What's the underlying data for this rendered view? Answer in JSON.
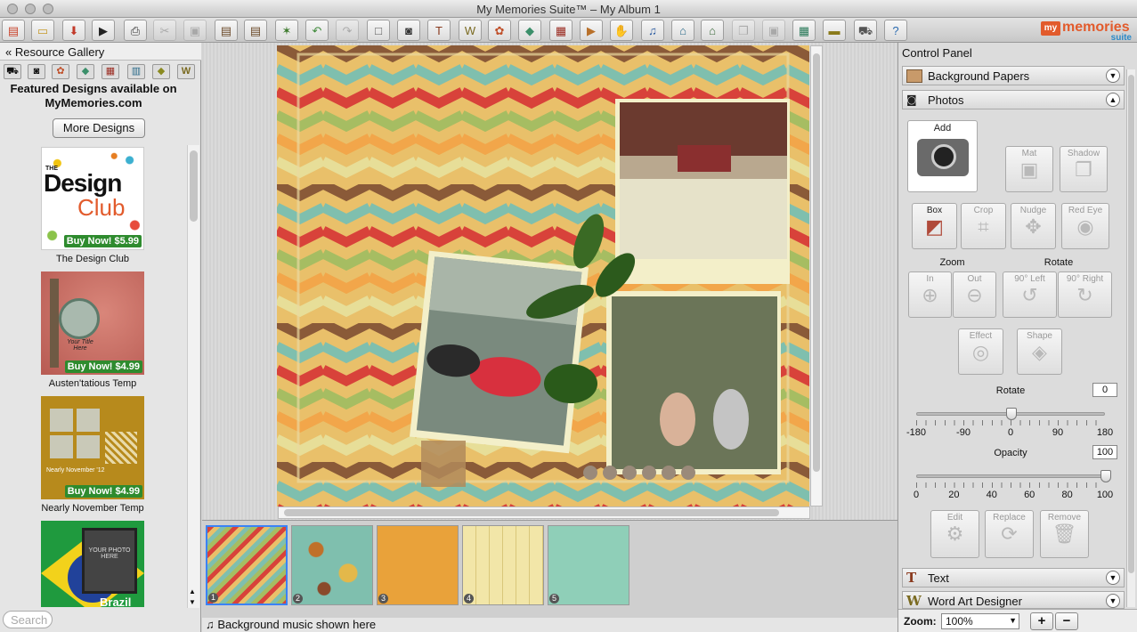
{
  "window": {
    "title": "My Memories Suite™ – My Album 1"
  },
  "toolbar": {
    "items": [
      {
        "name": "mm-home-icon",
        "glyph": "▤",
        "color": "#c9432c",
        "disabled": false
      },
      {
        "name": "open-folder-icon",
        "glyph": "▭",
        "color": "#c79a2a",
        "disabled": false
      },
      {
        "name": "save-icon",
        "glyph": "⬇",
        "color": "#c23a2a",
        "disabled": false
      },
      {
        "name": "play-icon",
        "glyph": "▶",
        "color": "#222",
        "disabled": false
      },
      {
        "name": "print-icon",
        "glyph": "⎙",
        "color": "#333",
        "disabled": false
      },
      {
        "name": "cut-icon",
        "glyph": "✂",
        "color": "#777",
        "disabled": true
      },
      {
        "name": "copy-icon",
        "glyph": "▣",
        "color": "#777",
        "disabled": true
      },
      {
        "name": "paste-icon",
        "glyph": "▤",
        "color": "#6b4a2a",
        "disabled": false
      },
      {
        "name": "paste-in-place-icon",
        "glyph": "▤",
        "color": "#6b4a2a",
        "disabled": false
      },
      {
        "name": "magic-wand-icon",
        "glyph": "✶",
        "color": "#3c7a2c",
        "disabled": false
      },
      {
        "name": "undo-icon",
        "glyph": "↶",
        "color": "#3f8a3a",
        "disabled": false
      },
      {
        "name": "redo-icon",
        "glyph": "↷",
        "color": "#777",
        "disabled": true
      },
      {
        "name": "new-page-icon",
        "glyph": "□",
        "color": "#555",
        "disabled": false
      },
      {
        "name": "camera-icon",
        "glyph": "◙",
        "color": "#333",
        "disabled": false
      },
      {
        "name": "text-icon",
        "glyph": "T",
        "color": "#8a3b1f",
        "disabled": false
      },
      {
        "name": "word-art-icon",
        "glyph": "W",
        "color": "#7a6a20",
        "disabled": false
      },
      {
        "name": "embellishment-icon",
        "glyph": "✿",
        "color": "#c0502a",
        "disabled": false
      },
      {
        "name": "tag-icon",
        "glyph": "◆",
        "color": "#3b8f6a",
        "disabled": false
      },
      {
        "name": "stamp-icon",
        "glyph": "▦",
        "color": "#9a2a20",
        "disabled": false
      },
      {
        "name": "video-icon",
        "glyph": "▶",
        "color": "#b8702a",
        "disabled": false
      },
      {
        "name": "hand-icon",
        "glyph": "✋",
        "color": "#9a5a3a",
        "disabled": false
      },
      {
        "name": "music-note-icon",
        "glyph": "♫",
        "color": "#2a5aa0",
        "disabled": false
      },
      {
        "name": "home-icon",
        "glyph": "⌂",
        "color": "#2a6a8a",
        "disabled": false
      },
      {
        "name": "template-icon",
        "glyph": "⌂",
        "color": "#3a6a3a",
        "disabled": false
      },
      {
        "name": "layers-icon",
        "glyph": "❐",
        "color": "#777",
        "disabled": true
      },
      {
        "name": "group-icon",
        "glyph": "▣",
        "color": "#777",
        "disabled": true
      },
      {
        "name": "grid-icon",
        "glyph": "▦",
        "color": "#2a7a5a",
        "disabled": false
      },
      {
        "name": "film-icon",
        "glyph": "▬",
        "color": "#8a7a1a",
        "disabled": false
      },
      {
        "name": "cart-icon",
        "glyph": "⛟",
        "color": "#555",
        "disabled": false
      },
      {
        "name": "help-icon",
        "glyph": "?",
        "color": "#2a6ab0",
        "disabled": false
      }
    ],
    "logo_top": "my",
    "logo_bottom": "memories",
    "logo_sub": "suite"
  },
  "gallery": {
    "header": "Resource Gallery",
    "collapse_glyph": "«",
    "featured_line1": "Featured Designs available on",
    "featured_line2": "MyMemories.com",
    "more_button": "More Designs",
    "cards": [
      {
        "title_line1": "THE",
        "title_big": "Design",
        "title_big2": "Club",
        "buy": "Buy Now! $5.99",
        "name": "The Design Club"
      },
      {
        "caption": "Your Title Here",
        "buy": "Buy Now! $4.99",
        "name": "Austen'tatious Temp"
      },
      {
        "caption": "Nearly November '12",
        "buy": "Buy Now! $4.99",
        "name": "Nearly November Temp"
      },
      {
        "caption": "YOUR PHOTO HERE",
        "word": "Brazil",
        "name": ""
      }
    ],
    "search_placeholder": "Search"
  },
  "filmstrip": {
    "thumbs": [
      {
        "num": "1",
        "selected": true
      },
      {
        "num": "2",
        "selected": false
      },
      {
        "num": "3",
        "selected": false
      },
      {
        "num": "4",
        "selected": false
      },
      {
        "num": "5",
        "selected": false
      }
    ],
    "music_label": "Background music shown here"
  },
  "control_panel": {
    "title": "Control Panel",
    "sections": {
      "background_papers": "Background Papers",
      "photos": "Photos",
      "text": "Text",
      "word_art": "Word Art Designer"
    },
    "photos": {
      "add": "Add",
      "mat": "Mat",
      "shadow": "Shadow",
      "box": "Box",
      "crop": "Crop",
      "nudge": "Nudge",
      "red_eye": "Red Eye",
      "zoom_label": "Zoom",
      "rotate_label": "Rotate",
      "zoom_in": "In",
      "zoom_out": "Out",
      "rot_left": "90° Left",
      "rot_right": "90° Right",
      "effect": "Effect",
      "shape": "Shape",
      "rotate_slider_label": "Rotate",
      "rotate_value": "0",
      "rotate_ticks": [
        "-180",
        "-90",
        "0",
        "90",
        "180"
      ],
      "rotate_level": 0.5,
      "opacity_label": "Opacity",
      "opacity_value": "100",
      "opacity_ticks": [
        "0",
        "20",
        "40",
        "60",
        "80",
        "100"
      ],
      "opacity_level": 1.0,
      "edit": "Edit",
      "replace": "Replace",
      "remove": "Remove"
    },
    "zoom": {
      "label": "Zoom:",
      "value": "100%",
      "plus": "+",
      "minus": "−"
    }
  }
}
